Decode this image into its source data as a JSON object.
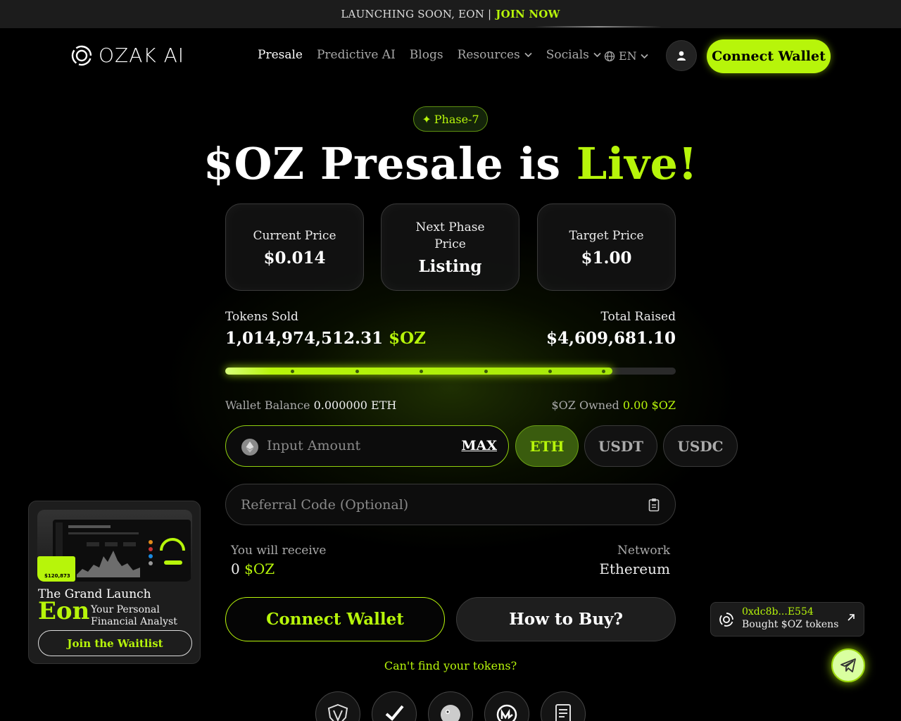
{
  "announcement": {
    "text": "LAUNCHING SOON, EON |",
    "cta": "JOIN NOW"
  },
  "nav": {
    "logo_text": "OZAK AI",
    "links": [
      "Presale",
      "Predictive AI",
      "Blogs",
      "Resources",
      "Socials"
    ],
    "language": "EN",
    "connect_label": "Connect Wallet"
  },
  "hero": {
    "phase": "Phase-7",
    "headline_main": "$OZ Presale is",
    "headline_accent": "Live!"
  },
  "prices": [
    {
      "label": "Current Price",
      "value": "$0.014"
    },
    {
      "label": "Next Phase Price",
      "value": "Listing"
    },
    {
      "label": "Target Price",
      "value": "$1.00"
    }
  ],
  "stats": {
    "tokens_sold_label": "Tokens Sold",
    "tokens_sold_value": "1,014,974,512.31",
    "tokens_sold_unit": "$OZ",
    "total_raised_label": "Total Raised",
    "total_raised_value": "$4,609,681.10",
    "progress_fraction": 0.86
  },
  "wallet": {
    "balance_label": "Wallet Balance",
    "balance_value": "0.000000 ETH",
    "owned_label": "$OZ Owned",
    "owned_value": "0.00 $OZ"
  },
  "purchase": {
    "amount_placeholder": "Input Amount",
    "max_label": "MAX",
    "currencies": [
      "ETH",
      "USDT",
      "USDC"
    ],
    "selected_currency": "ETH",
    "referral_placeholder": "Referral Code (Optional)",
    "receive_label": "You will receive",
    "receive_value": "0",
    "receive_unit": "$OZ",
    "network_label": "Network",
    "network_value": "Ethereum",
    "connect_label": "Connect Wallet",
    "how_label": "How to Buy?",
    "cant_find": "Can't find your tokens?"
  },
  "promo": {
    "title": "The Grand Launch",
    "product": "Eon",
    "subtitle_line1": "Your Personal",
    "subtitle_line2": "Financial Analyst",
    "button": "Join the Waitlist"
  },
  "toast": {
    "address": "0xdc8b...E554",
    "message": "Bought $OZ tokens"
  },
  "colors": {
    "accent": "#b7f50a",
    "background": "#000000"
  }
}
